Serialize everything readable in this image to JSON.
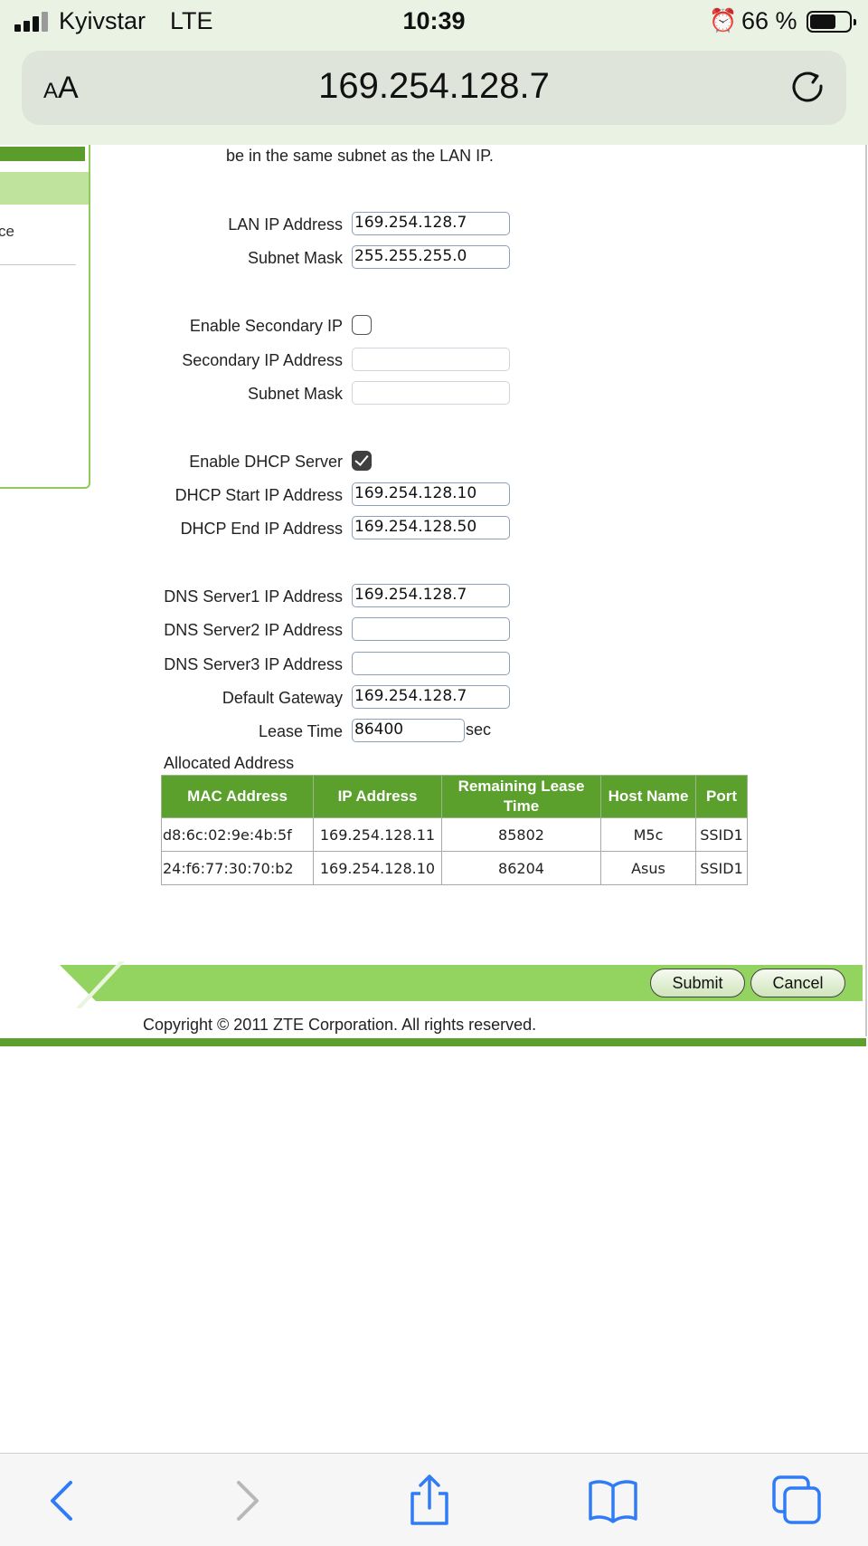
{
  "status_bar": {
    "carrier": "Kyivstar",
    "network": "LTE",
    "time": "10:39",
    "battery": "66 %",
    "battery_level": 0.66
  },
  "browser": {
    "text_size_label_small": "A",
    "text_size_label_large": "A",
    "url": "169.254.128.7"
  },
  "sidebar": {
    "item_text": "ce"
  },
  "lan": {
    "intro": "be in the same subnet as the LAN IP.",
    "lan_ip_label": "LAN IP Address",
    "lan_ip_value": "169.254.128.7",
    "subnet_label": "Subnet Mask",
    "subnet_value": "255.255.255.0",
    "secondary_enable_label": "Enable Secondary IP",
    "secondary_enabled": false,
    "secondary_ip_label": "Secondary IP Address",
    "secondary_ip_value": "",
    "secondary_mask_label": "Subnet Mask",
    "secondary_mask_value": "",
    "dhcp_enable_label": "Enable DHCP Server",
    "dhcp_enabled": true,
    "dhcp_start_label": "DHCP Start IP Address",
    "dhcp_start_value": "169.254.128.10",
    "dhcp_end_label": "DHCP End IP Address",
    "dhcp_end_value": "169.254.128.50",
    "dns1_label": "DNS Server1 IP Address",
    "dns1_value": "169.254.128.7",
    "dns2_label": "DNS Server2 IP Address",
    "dns2_value": "",
    "dns3_label": "DNS Server3 IP Address",
    "dns3_value": "",
    "gateway_label": "Default Gateway",
    "gateway_value": "169.254.128.7",
    "lease_label": "Lease Time",
    "lease_value": "86400",
    "lease_unit": "sec"
  },
  "allocated": {
    "title": "Allocated Address",
    "headers": [
      "MAC Address",
      "IP Address",
      "Remaining Lease Time",
      "Host Name",
      "Port"
    ],
    "rows": [
      [
        "d8:6c:02:9e:4b:5f",
        "169.254.128.11",
        "85802",
        "M5c",
        "SSID1"
      ],
      [
        "24:f6:77:30:70:b2",
        "169.254.128.10",
        "86204",
        "Asus",
        "SSID1"
      ]
    ]
  },
  "actions": {
    "submit": "Submit",
    "cancel": "Cancel"
  },
  "footer": {
    "copyright": "Copyright © 2011 ZTE Corporation. All rights reserved."
  },
  "colors": {
    "accent_dark": "#5b9f2d",
    "accent_light": "#93d461",
    "link_blue": "#2f7cf6"
  },
  "toolbar_icons": [
    "back-icon",
    "forward-icon",
    "share-icon",
    "bookmarks-icon",
    "tabs-icon"
  ]
}
